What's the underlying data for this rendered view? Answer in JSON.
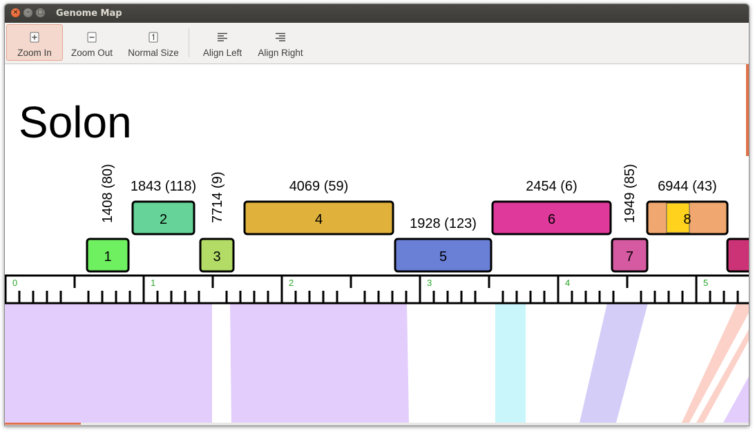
{
  "window": {
    "title": "Genome Map"
  },
  "toolbar": {
    "buttons": [
      {
        "id": "zoom-in",
        "label": "Zoom In",
        "icon": "zoom-in-icon",
        "active": true
      },
      {
        "id": "zoom-out",
        "label": "Zoom Out",
        "icon": "zoom-out-icon",
        "active": false
      },
      {
        "id": "normal-size",
        "label": "Normal Size",
        "icon": "normal-size-icon",
        "active": false
      },
      {
        "id": "align-left",
        "label": "Align Left",
        "icon": "align-left-icon",
        "active": false
      },
      {
        "id": "align-right",
        "label": "Align Right",
        "icon": "align-right-icon",
        "active": false
      }
    ]
  },
  "genome": {
    "name": "Solon",
    "genes": [
      {
        "number": "1",
        "label": "1408 (80)",
        "label_vertical": true,
        "color": "#6ef060"
      },
      {
        "number": "2",
        "label": "1843 (118)",
        "label_vertical": false,
        "color": "#66d498"
      },
      {
        "number": "3",
        "label": "7714 (9)",
        "label_vertical": true,
        "color": "#b2dc66"
      },
      {
        "number": "4",
        "label": "4069 (59)",
        "label_vertical": false,
        "color": "#e0b23c"
      },
      {
        "number": "5",
        "label": "1928 (123)",
        "label_vertical": false,
        "color": "#6a7fd6"
      },
      {
        "number": "6",
        "label": "2454 (6)",
        "label_vertical": false,
        "color": "#e0399c"
      },
      {
        "number": "7",
        "label": "1949 (85)",
        "label_vertical": true,
        "color": "#d65aa2"
      },
      {
        "number": "8",
        "label": "6944 (43)",
        "label_vertical": false,
        "color": "#f0a870",
        "highlight_color": "#ffd21e"
      },
      {
        "number": "",
        "label": "",
        "label_vertical": false,
        "color": "#cc3377"
      }
    ],
    "ruler": {
      "tick_labels": [
        "0",
        "1",
        "2",
        "3",
        "4",
        "5"
      ],
      "label_color": "#2aa52a"
    }
  },
  "colors": {
    "accent": "#e0714a",
    "purple_block": "#e2cdfd",
    "cyan_block": "#c9f6fb",
    "lavender_block": "#d3cdf8",
    "salmon_line": "#fbd1c8"
  }
}
